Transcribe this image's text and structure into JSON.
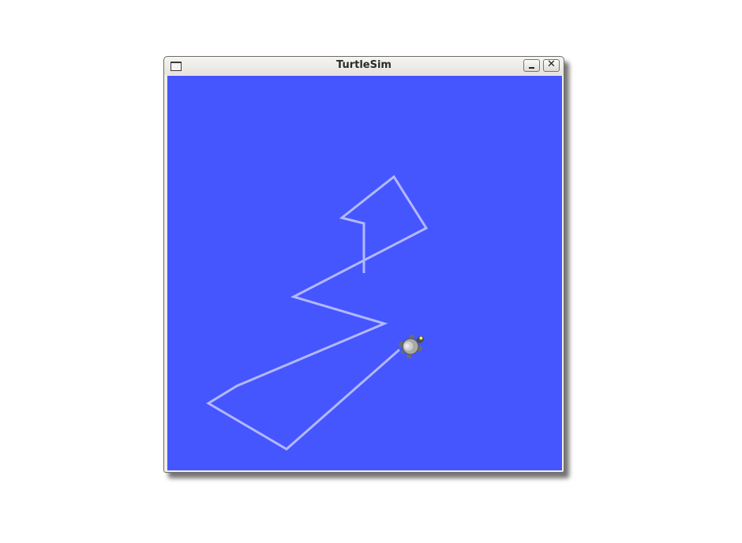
{
  "window": {
    "title": "TurtleSim",
    "close_glyph": "✕",
    "icons": {
      "window_menu": "window-menu-icon",
      "minimize": "minimize-icon",
      "close": "close-icon"
    }
  },
  "simulation": {
    "background_color": "#4556ff",
    "pen_color": "#b3b8ff",
    "turtle": "turtle-icon"
  }
}
